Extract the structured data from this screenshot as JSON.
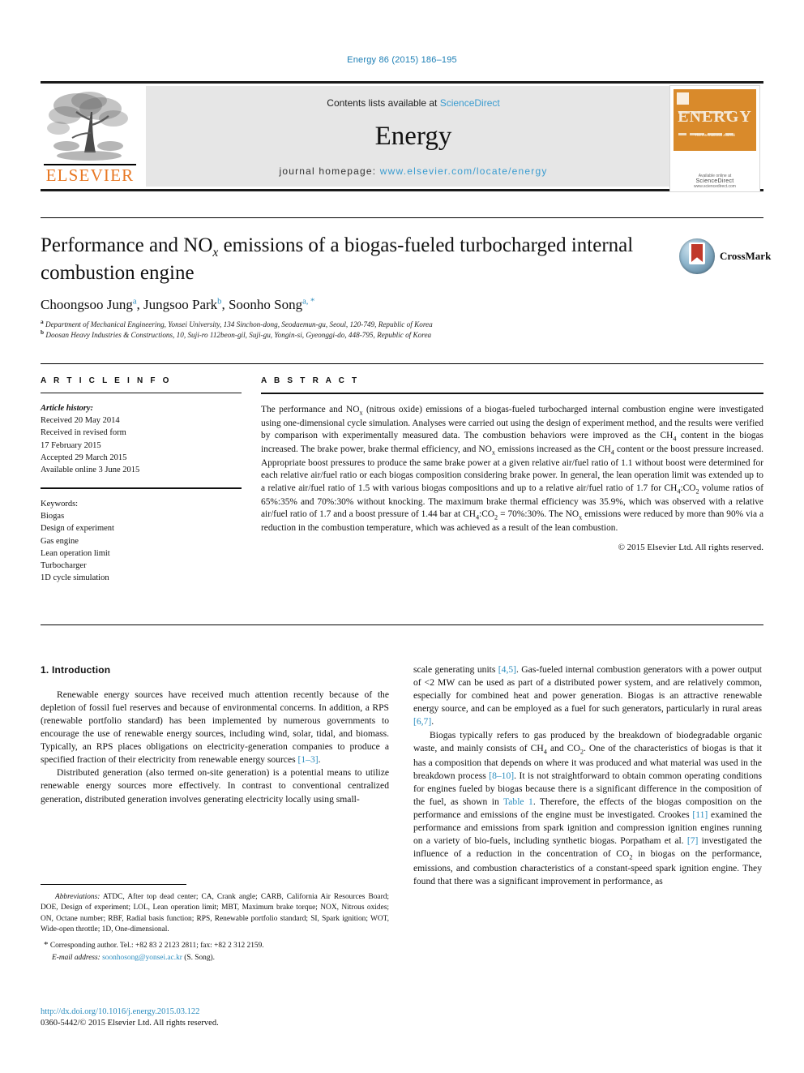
{
  "running_head": "Energy 86 (2015) 186–195",
  "masthead": {
    "contents_prefix": "Contents lists available at ",
    "contents_link": "ScienceDirect",
    "journal_title": "Energy",
    "homepage_prefix": "journal homepage: ",
    "homepage_link": "www.elsevier.com/locate/energy",
    "publisher_wordmark": "ELSEVIER",
    "cover_title": "ENERGY",
    "cover_subtitle": "The International Journal",
    "cover_footer_small": "Available online at",
    "cover_footer": "ScienceDirect",
    "cover_footer_url": "www.sciencedirect.com"
  },
  "crossmark": {
    "label": "CrossMark"
  },
  "article": {
    "title_line1": "Performance and NO",
    "title_sub": "x",
    "title_line1_rest": " emissions of a biogas-fueled turbocharged",
    "title_line2": "internal combustion engine",
    "authors_html": "Choongsoo Jung, Jungsoo Park, Soonho Song",
    "authors": [
      {
        "name": "Choongsoo Jung",
        "marks": "a"
      },
      {
        "name": "Jungsoo Park",
        "marks": "b"
      },
      {
        "name": "Soonho Song",
        "marks": "a, *"
      }
    ],
    "affiliations": [
      {
        "mark": "a",
        "text": "Department of Mechanical Engineering, Yonsei University, 134 Sinchon-dong, Seodaemun-gu, Seoul, 120-749, Republic of Korea"
      },
      {
        "mark": "b",
        "text": "Doosan Heavy Industries & Constructions, 10, Suji-ro 112beon-gil, Suji-gu, Yongin-si, Gyeonggi-do, 448-795, Republic of Korea"
      }
    ]
  },
  "article_info": {
    "heading": "A R T I C L E  I N F O",
    "history_label": "Article history:",
    "history": [
      "Received 20 May 2014",
      "Received in revised form",
      "17 February 2015",
      "Accepted 29 March 2015",
      "Available online 3 June 2015"
    ],
    "keywords_label": "Keywords:",
    "keywords": [
      "Biogas",
      "Design of experiment",
      "Gas engine",
      "Lean operation limit",
      "Turbocharger",
      "1D cycle simulation"
    ]
  },
  "abstract": {
    "heading": "A B S T R A C T",
    "paragraphs": [
      "The performance and NO<sub>x</sub> (nitrous oxide) emissions of a biogas-fueled turbocharged internal combustion engine were investigated using one-dimensional cycle simulation. Analyses were carried out using the design of experiment method, and the results were verified by comparison with experimentally measured data. The combustion behaviors were improved as the CH<sub>4</sub> content in the biogas increased. The brake power, brake thermal efficiency, and NO<sub>x</sub> emissions increased as the CH<sub>4</sub> content or the boost pressure increased. Appropriate boost pressures to produce the same brake power at a given relative air/fuel ratio of 1.1 without boost were determined for each relative air/fuel ratio or each biogas composition considering brake power. In general, the lean operation limit was extended up to a relative air/fuel ratio of 1.5 with various biogas compositions and up to a relative air/fuel ratio of 1.7 for CH<sub>4</sub>:CO<sub>2</sub> volume ratios of 65%:35% and 70%:30% without knocking. The maximum brake thermal efficiency was 35.9%, which was observed with a relative air/fuel ratio of 1.7 and a boost pressure of 1.44 bar at CH<sub>4</sub>:CO<sub>2</sub> = 70%:30%. The NO<sub>x</sub> emissions were reduced by more than 90% via a reduction in the combustion temperature, which was achieved as a result of the lean combustion."
    ],
    "copyright": "© 2015 Elsevier Ltd. All rights reserved."
  },
  "body": {
    "section_heading": "1. Introduction",
    "left_paragraphs": [
      "Renewable energy sources have received much attention recently because of the depletion of fossil fuel reserves and because of environmental concerns. In addition, a RPS (renewable portfolio standard) has been implemented by numerous governments to encourage the use of renewable energy sources, including wind, solar, tidal, and biomass. Typically, an RPS places obligations on electricity-generation companies to produce a specified fraction of their electricity from renewable energy sources <span class=\"ref\">[1–3]</span>.",
      "Distributed generation (also termed on-site generation) is a potential means to utilize renewable energy sources more effectively. In contrast to conventional centralized generation, distributed generation involves generating electricity locally using small-"
    ],
    "right_paragraphs": [
      "scale generating units <span class=\"ref\">[4,5]</span>. Gas-fueled internal combustion generators with a power output of &lt;2 MW can be used as part of a distributed power system, and are relatively common, especially for combined heat and power generation. Biogas is an attractive renewable energy source, and can be employed as a fuel for such generators, particularly in rural areas <span class=\"ref\">[6,7]</span>.",
      "Biogas typically refers to gas produced by the breakdown of biodegradable organic waste, and mainly consists of CH<sub>4</sub> and CO<sub>2</sub>. One of the characteristics of biogas is that it has a composition that depends on where it was produced and what material was used in the breakdown process <span class=\"ref\">[8–10]</span>. It is not straightforward to obtain common operating conditions for engines fueled by biogas because there is a significant difference in the composition of the fuel, as shown in <span class=\"ref\">Table 1</span>. Therefore, the effects of the biogas composition on the performance and emissions of the engine must be investigated. Crookes <span class=\"ref\">[11]</span> examined the performance and emissions from spark ignition and compression ignition engines running on a variety of bio-fuels, including synthetic biogas. Porpatham et al. <span class=\"ref\">[7]</span> investigated the influence of a reduction in the concentration of CO<sub>2</sub> in biogas on the performance, emissions, and combustion characteristics of a constant-speed spark ignition engine. They found that there was a significant improvement in performance, as"
    ]
  },
  "footnotes": {
    "abbreviations_label": "Abbreviations:",
    "abbreviations_text": " ATDC, After top dead center; CA, Crank angle; CARB, California Air Resources Board; DOE, Design of experiment; LOL, Lean operation limit; MBT, Maximum brake torque; NOX, Nitrous oxides; ON, Octane number; RBF, Radial basis function; RPS, Renewable portfolio standard; SI, Spark ignition; WOT, Wide-open throttle; 1D, One-dimensional.",
    "corresponding": "Corresponding author. Tel.: +82 83 2 2123 2811; fax: +82 2 312 2159.",
    "email_label": "E-mail address:",
    "email": "soonhosong@yonsei.ac.kr",
    "email_suffix": " (S. Song)."
  },
  "footer": {
    "doi": "http://dx.doi.org/10.1016/j.energy.2015.03.122",
    "issn_line": "0360-5442/© 2015 Elsevier Ltd. All rights reserved."
  },
  "colors": {
    "link_blue": "#2b8cbe",
    "elsevier_orange": "#e87722",
    "banner_grey": "#e6e6e6"
  }
}
